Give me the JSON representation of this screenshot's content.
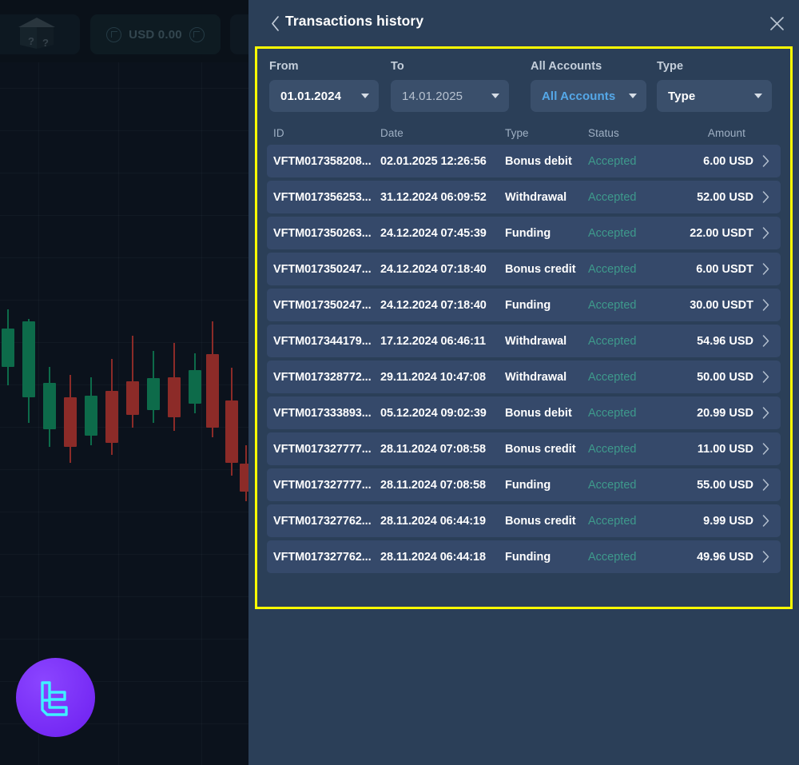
{
  "background_app": {
    "balance_chip": {
      "label": "USD 0.00",
      "refresh_icon": "refresh-icon",
      "add_icon": "add-icon"
    },
    "mystery_box": {
      "glyph_left": "?",
      "glyph_right": "?"
    },
    "logo": "brand-logo"
  },
  "panel": {
    "header": {
      "back_icon": "chevron-left-icon",
      "title": "Transactions history",
      "close_icon": "close-icon"
    },
    "filters": [
      {
        "label": "From",
        "value": "01.01.2024",
        "style": "strong",
        "name": "from-date"
      },
      {
        "label": "To",
        "value": "14.01.2025",
        "style": "muted",
        "name": "to-date"
      },
      {
        "label": "All Accounts",
        "value": "All Accounts",
        "style": "accent",
        "name": "account-select"
      },
      {
        "label": "Type",
        "value": "Type",
        "style": "strong",
        "name": "type-select"
      }
    ],
    "table": {
      "columns": [
        "ID",
        "Date",
        "Type",
        "Status",
        "Amount"
      ],
      "rows": [
        {
          "id": "VFTM017358208...",
          "date": "02.01.2025 12:26:56",
          "type": "Bonus debit",
          "status": "Accepted",
          "amount": "6.00 USD"
        },
        {
          "id": "VFTM017356253...",
          "date": "31.12.2024 06:09:52",
          "type": "Withdrawal",
          "status": "Accepted",
          "amount": "52.00 USD"
        },
        {
          "id": "VFTM017350263...",
          "date": "24.12.2024 07:45:39",
          "type": "Funding",
          "status": "Accepted",
          "amount": "22.00 USDT"
        },
        {
          "id": "VFTM017350247...",
          "date": "24.12.2024 07:18:40",
          "type": "Bonus credit",
          "status": "Accepted",
          "amount": "6.00 USDT"
        },
        {
          "id": "VFTM017350247...",
          "date": "24.12.2024 07:18:40",
          "type": "Funding",
          "status": "Accepted",
          "amount": "30.00 USDT"
        },
        {
          "id": "VFTM017344179...",
          "date": "17.12.2024 06:46:11",
          "type": "Withdrawal",
          "status": "Accepted",
          "amount": "54.96 USD"
        },
        {
          "id": "VFTM017328772...",
          "date": "29.11.2024 10:47:08",
          "type": "Withdrawal",
          "status": "Accepted",
          "amount": "50.00 USD"
        },
        {
          "id": "VFTM017333893...",
          "date": "05.12.2024 09:02:39",
          "type": "Bonus debit",
          "status": "Accepted",
          "amount": "20.99 USD"
        },
        {
          "id": "VFTM017327777...",
          "date": "28.11.2024 07:08:58",
          "type": "Bonus credit",
          "status": "Accepted",
          "amount": "11.00 USD"
        },
        {
          "id": "VFTM017327777...",
          "date": "28.11.2024 07:08:58",
          "type": "Funding",
          "status": "Accepted",
          "amount": "55.00 USD"
        },
        {
          "id": "VFTM017327762...",
          "date": "28.11.2024 06:44:19",
          "type": "Bonus credit",
          "status": "Accepted",
          "amount": "9.99 USD"
        },
        {
          "id": "VFTM017327762...",
          "date": "28.11.2024 06:44:18",
          "type": "Funding",
          "status": "Accepted",
          "amount": "49.96 USD"
        }
      ]
    }
  },
  "colors": {
    "panel_bg": "#2b3f58",
    "row_bg": "#35496a",
    "accent_blue": "#55a8e8",
    "status_green": "#3e9a8c",
    "highlight_yellow": "#ffff00",
    "logo_purple": "#7b2ff7",
    "logo_cyan": "#3ff0ff",
    "candle_up": "#0d6b4a",
    "candle_down": "#8c2b28"
  }
}
